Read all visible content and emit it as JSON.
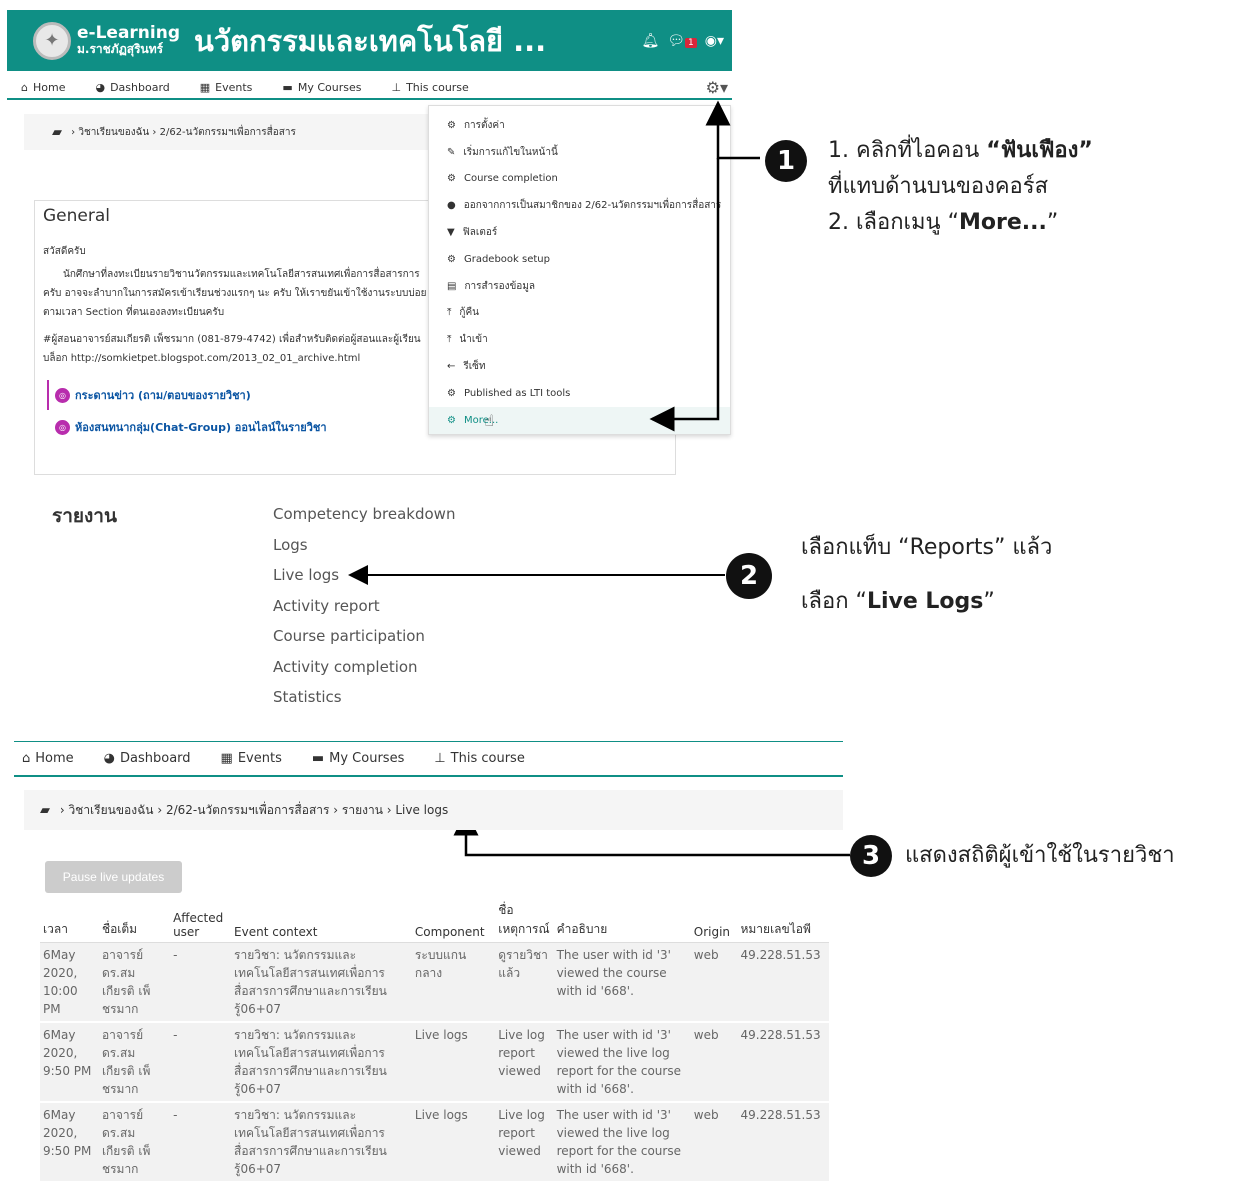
{
  "header": {
    "brand_top": "e-Learning",
    "brand_bottom": "ม.ราชภัฏสุรินทร์",
    "site_name": "นวัตกรรมและเทคโนโลยี ...",
    "notification_count": "1"
  },
  "nav": {
    "home": "Home",
    "dashboard": "Dashboard",
    "events": "Events",
    "my_courses": "My Courses",
    "this_course": "This course"
  },
  "breadcrumb1": {
    "my_courses": "วิชาเรียนของฉัน",
    "course": "2/62-นวัตกรรมฯเพื่อการสื่อสาร"
  },
  "general": {
    "title": "General",
    "greeting": "สวัสดีครับ",
    "para1_line1": "นักศึกษาที่ลงทะเบียนรายวิชานวัตกรรมและเทคโนโลยีสารสนเทศเพื่อการสื่อสารการ",
    "para1_line2": "ครับ อาจจะลำบากในการสมัครเข้าเรียนช่วงแรกๆ นะ ครับ ให้เราขยันเข้าใช้งานระบบบ่อย",
    "para1_line3": "ตามเวลา Section ที่ตนเองลงทะเบียนครับ",
    "para2_line1": "#ผู้สอนอาจารย์สมเกียรติ เพ็ชรมาก (081-879-4742) เพื่อสำหรับติดต่อผู้สอนและผู้เรียน",
    "para2_line2": "บล็อก http://somkietpet.blogspot.com/2013_02_01_archive.html",
    "activity1": "กระดานข่าว (ถาม/ตอบของรายวิชา)",
    "activity2": "ห้องสนทนากลุ่ม(Chat-Group) ออนไลน์ในรายวิชา"
  },
  "dropdown": [
    {
      "icon": "gear-icon",
      "label": "การตั้งค่า"
    },
    {
      "icon": "pencil-icon",
      "label": "เริ่มการแก้ไขในหน้านี้"
    },
    {
      "icon": "gear-icon",
      "label": "Course completion"
    },
    {
      "icon": "user-icon",
      "label": "ออกจากการเป็นสมาชิกของ 2/62-นวัตกรรมฯเพื่อการสื่อสาร"
    },
    {
      "icon": "filter-icon",
      "label": "ฟิลเตอร์"
    },
    {
      "icon": "gear-icon",
      "label": "Gradebook setup"
    },
    {
      "icon": "file-icon",
      "label": "การสำรองข้อมูล"
    },
    {
      "icon": "upload-icon",
      "label": "กู้คืน"
    },
    {
      "icon": "upload-icon",
      "label": "นำเข้า"
    },
    {
      "icon": "arrow-left-icon",
      "label": "รีเซ็ท"
    },
    {
      "icon": "gear-icon",
      "label": "Published as LTI tools"
    },
    {
      "icon": "gear-icon",
      "label": "More..."
    }
  ],
  "annotations": {
    "step1_number": "1",
    "step1_line1_a": "1. คลิกที่ไอคอน ",
    "step1_line1_b": "“ฟันเฟือง”",
    "step1_line2": "ที่แทบด้านบนของคอร์ส",
    "step1_line3_a": "2. เลือกเมนู “",
    "step1_line3_b": "More...",
    "step1_line3_c": "”",
    "step2_number": "2",
    "step2_line1": "เลือกแท็บ “Reports” แล้ว",
    "step2_line2_a": "เลือก “",
    "step2_line2_b": "Live Logs",
    "step2_line2_c": "”",
    "step3_number": "3",
    "step3_text": "แสดงสถิติผู้เข้าใช้ในรายวิชา"
  },
  "reports": {
    "title": "รายงาน",
    "links": [
      "Competency breakdown",
      "Logs",
      "Live logs",
      "Activity report",
      "Course participation",
      "Activity completion",
      "Statistics"
    ]
  },
  "breadcrumb2": {
    "my_courses": "วิชาเรียนของฉัน",
    "course": "2/62-นวัตกรรมฯเพื่อการสื่อสาร",
    "reports": "รายงาน",
    "current": "Live logs"
  },
  "pause_button": "Pause live updates",
  "log_table": {
    "headers": [
      "เวลา",
      "ชื่อเต็ม",
      "Affected user",
      "Event context",
      "Component",
      "ชื่อเหตุการณ์",
      "คำอธิบาย",
      "Origin",
      "หมายเลขไอพี"
    ],
    "rows": [
      [
        "6May 2020, 10:00 PM",
        "อาจารย์ ดร.สม เกียรติ เพ็ ชรมาก",
        "-",
        "รายวิชา: นวัตกรรมและเทคโนโลยีสารสนเทศเพื่อการสื่อสารการศึกษาและการเรียนรู้06+07",
        "ระบบแกนกลาง",
        "ดูรายวิชาแล้ว",
        "The user with id '3' viewed the course with id '668'.",
        "web",
        "49.228.51.53"
      ],
      [
        "6May 2020, 9:50 PM",
        "อาจารย์ ดร.สม เกียรติ เพ็ ชรมาก",
        "-",
        "รายวิชา: นวัตกรรมและเทคโนโลยีสารสนเทศเพื่อการสื่อสารการศึกษาและการเรียนรู้06+07",
        "Live logs",
        "Live log report viewed",
        "The user with id '3' viewed the live log report for the course with id '668'.",
        "web",
        "49.228.51.53"
      ],
      [
        "6May 2020, 9:50 PM",
        "อาจารย์ ดร.สม เกียรติ เพ็ ชรมาก",
        "-",
        "รายวิชา: นวัตกรรมและเทคโนโลยีสารสนเทศเพื่อการสื่อสารการศึกษาและการเรียนรู้06+07",
        "Live logs",
        "Live log report viewed",
        "The user with id '3' viewed the live log report for the course with id '668'.",
        "web",
        "49.228.51.53"
      ]
    ]
  }
}
